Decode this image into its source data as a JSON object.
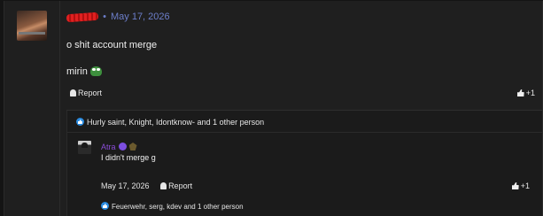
{
  "post": {
    "username": "",
    "separator": "•",
    "date": "May 17, 2026",
    "lines": [
      "o shit account merge",
      "mirin"
    ],
    "report_label": "Report",
    "like_count": "+1",
    "reactions": "Hurly saint, Knight, Idontknow- and 1 other person"
  },
  "reply": {
    "username": "Atra",
    "text": "I didn't merge g",
    "date": "May 17, 2026",
    "report_label": "Report",
    "like_count": "+1",
    "reactions": "Feuerwehr, serg, kdev and 1 other person"
  },
  "colors": {
    "background": "#141414",
    "panel": "#1f1f1f",
    "date_link": "#6c7ec9",
    "reply_username": "#8a4cd6",
    "like_badge": "#2a8be0",
    "redaction": "#e02020"
  },
  "icons": [
    "avatar",
    "frog-emoji-icon",
    "bell-icon",
    "thumbs-up-icon",
    "like-badge-icon",
    "verified-icon",
    "medal-icon"
  ]
}
